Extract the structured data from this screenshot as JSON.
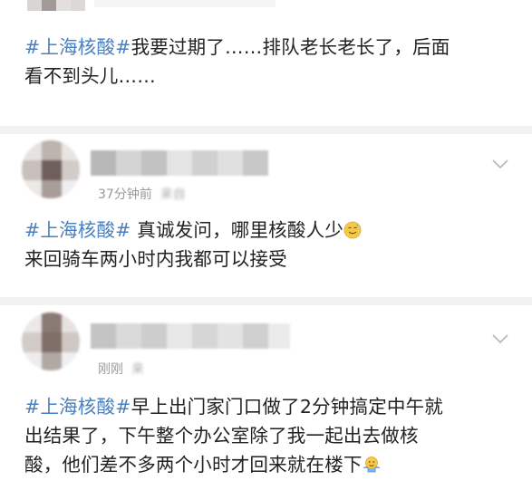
{
  "posts": [
    {
      "tag": "#上海核酸#",
      "text_lines": [
        "我要过期了……排队老长老长了，后面",
        "看不到头儿……"
      ]
    },
    {
      "time": "37分钟前",
      "source": "来自",
      "tag": "#上海核酸#",
      "text_lines": [
        " 真诚发问，哪里核酸人少",
        "来回骑车两小时内我都可以接受"
      ],
      "emoji": "sweat-smile-emoji"
    },
    {
      "time": "刚刚",
      "source": "来",
      "tag": "#上海核酸#",
      "text_lines": [
        "早上出门家门口做了2分钟搞定中午就",
        "出结果了，下午整个办公室除了我一起出去做核",
        "酸，他们差不多两个小时才回来就在楼下"
      ],
      "emoji": "shrug-emoji"
    }
  ],
  "icons": {
    "chevron": "chevron-down-icon"
  },
  "colors": {
    "tag": "#4a7fbf",
    "text": "#222222",
    "meta": "#9a9a9a",
    "divider": "#f2f2f2"
  }
}
